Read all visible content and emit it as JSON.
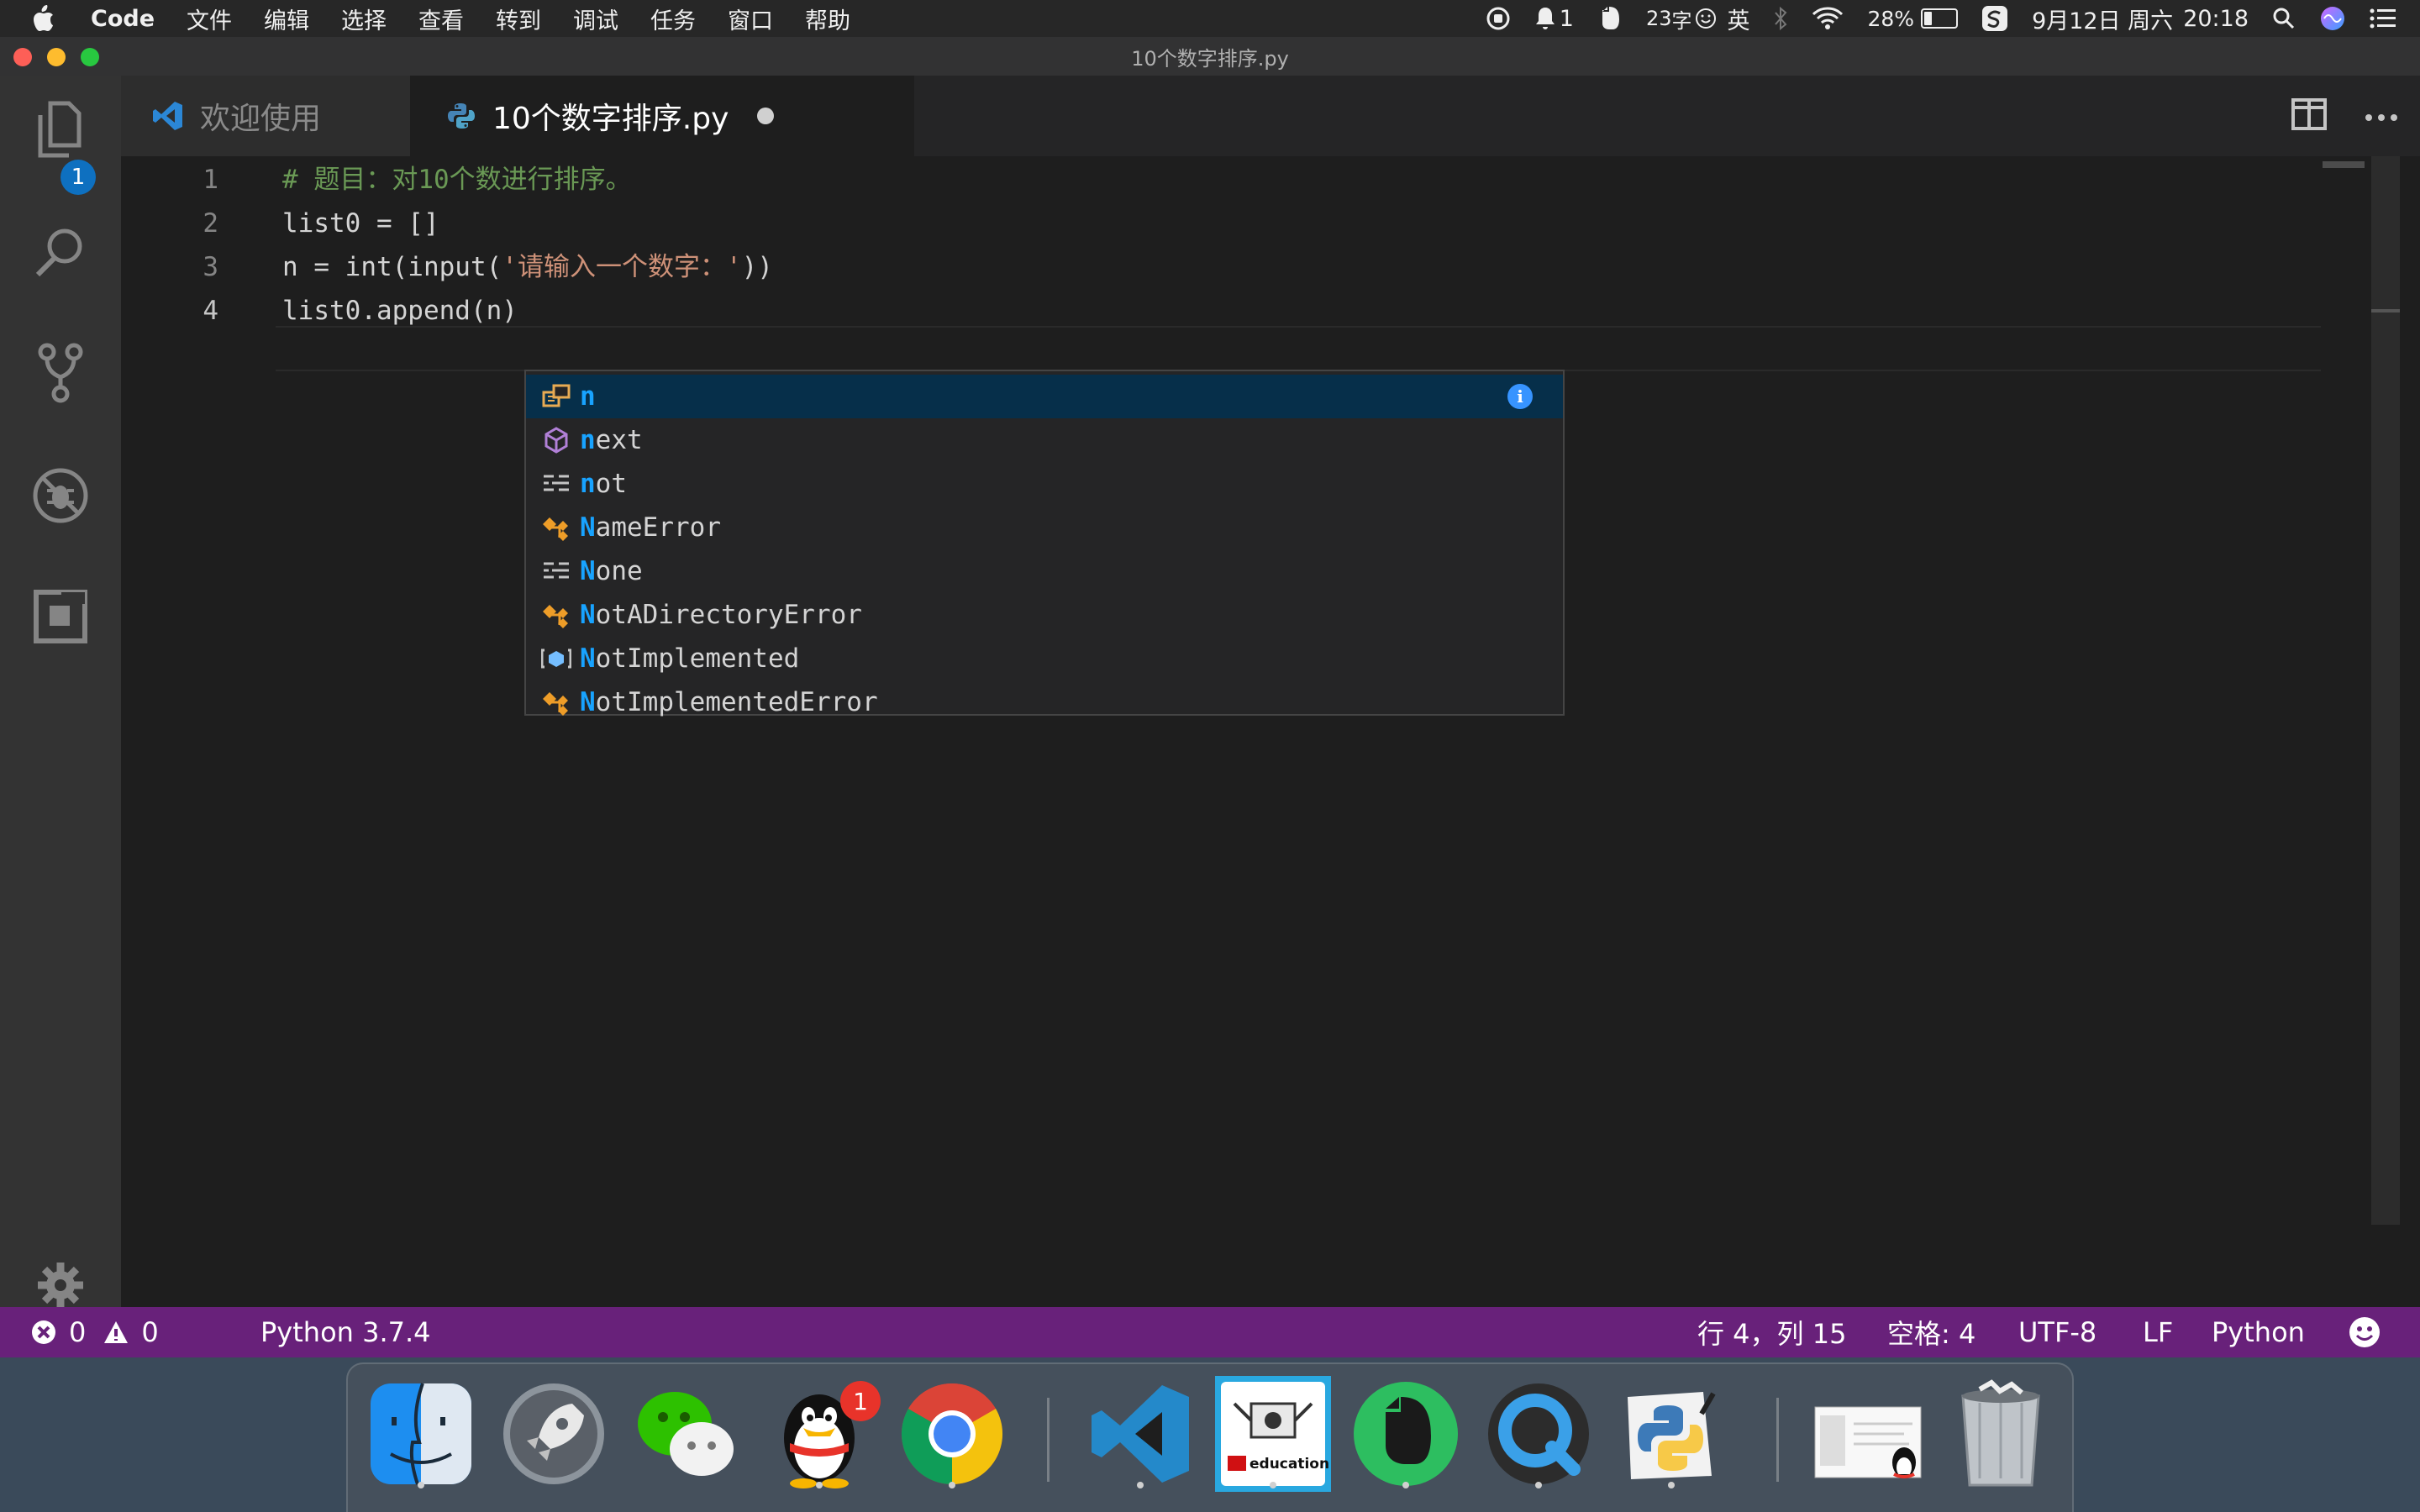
{
  "menubar": {
    "app_name": "Code",
    "items": [
      "文件",
      "编辑",
      "选择",
      "查看",
      "转到",
      "调试",
      "任务",
      "窗口",
      "帮助"
    ],
    "status": {
      "notification_count": "1",
      "temperature": "23",
      "input_char": "字",
      "language": "英",
      "battery_percent": "28%",
      "battery_level": 0.28,
      "date": "9月12日 周六",
      "time": "20:18"
    }
  },
  "window": {
    "title": "10个数字排序.py"
  },
  "activity": {
    "explorer_badge": "1"
  },
  "tabs": [
    {
      "label": "欢迎使用",
      "active": false
    },
    {
      "label": "10个数字排序.py",
      "active": true,
      "dirty": true
    }
  ],
  "editor": {
    "line_numbers": [
      "1",
      "2",
      "3",
      "4"
    ],
    "lines": {
      "l1_comment": "# 题目：对10个数进行排序。",
      "l2": "list0 = []",
      "l3_pre": "n = int(input(",
      "l3_str": "'请输入一个数字：'",
      "l3_post": "))",
      "l4": "list0.append(n)"
    }
  },
  "suggest": {
    "items": [
      {
        "match": "n",
        "rest": "",
        "kind": "variable-icon",
        "selected": true
      },
      {
        "match": "n",
        "rest": "ext",
        "kind": "module-icon"
      },
      {
        "match": "n",
        "rest": "ot",
        "kind": "keyword-icon"
      },
      {
        "match": "N",
        "rest": "ameError",
        "kind": "class-icon"
      },
      {
        "match": "N",
        "rest": "one",
        "kind": "keyword-icon"
      },
      {
        "match": "N",
        "rest": "otADirectoryError",
        "kind": "class-icon"
      },
      {
        "match": "N",
        "rest": "otImplemented",
        "kind": "enum-icon"
      },
      {
        "match": "N",
        "rest": "otImplementedError",
        "kind": "class-icon"
      }
    ],
    "info_glyph": "i"
  },
  "statusbar": {
    "errors": "0",
    "warnings": "0",
    "interpreter": "Python 3.7.4",
    "position": "行 4，列 15",
    "indent": "空格: 4",
    "encoding": "UTF-8",
    "eol": "LF",
    "language": "Python"
  },
  "dock": {
    "apps": [
      "Finder",
      "Launchpad",
      "WeChat",
      "QQ",
      "Chrome",
      "VS Code",
      "LEGO Education",
      "Evernote",
      "QuickTime Player",
      "Python Launcher",
      "Downloads",
      "Trash"
    ],
    "qq_badge": "1",
    "lego_label": "education"
  },
  "colors": {
    "statusbar": "#68217a",
    "editor_bg": "#1e1e1e",
    "activitybar": "#333333",
    "suggest_highlight": "#18a3ff",
    "comment": "#6a9955",
    "string": "#ce9178"
  }
}
